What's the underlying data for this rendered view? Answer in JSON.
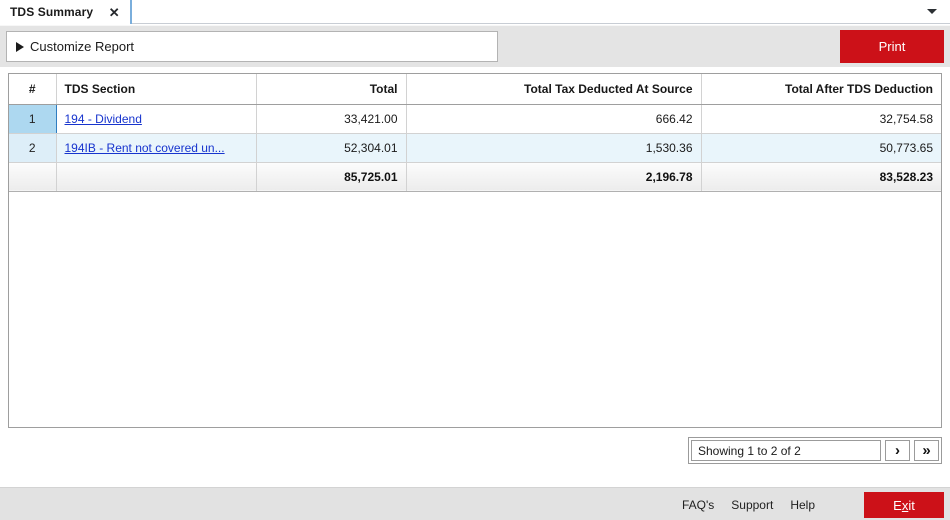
{
  "tabbar": {
    "tabs": [
      {
        "label": "TDS Summary",
        "close_icon": "close-icon"
      }
    ],
    "dropdown_icon": "chevron-down-icon"
  },
  "toolbar": {
    "customize_label": "Customize Report",
    "customize_icon": "triangle-right-icon",
    "print_label": "Print"
  },
  "grid": {
    "columns": [
      {
        "key": "num",
        "label": "#"
      },
      {
        "key": "sec",
        "label": "TDS Section"
      },
      {
        "key": "total",
        "label": "Total"
      },
      {
        "key": "tds",
        "label": "Total Tax Deducted At Source"
      },
      {
        "key": "after",
        "label": "Total After TDS Deduction"
      }
    ],
    "rows": [
      {
        "num": "1",
        "section": "194 - Dividend",
        "total": "33,421.00",
        "tds": "666.42",
        "after": "32,754.58"
      },
      {
        "num": "2",
        "section": "194IB  -  Rent  not  covered  un...",
        "total": "52,304.01",
        "tds": "1,530.36",
        "after": "50,773.65"
      }
    ],
    "totals": {
      "num": "",
      "section": "",
      "total": "85,725.01",
      "tds": "2,196.78",
      "after": "83,528.23"
    }
  },
  "pager": {
    "status": "Showing 1 to 2 of 2",
    "next_label": "›",
    "last_label": "»"
  },
  "footer": {
    "links": [
      {
        "label": "FAQ's"
      },
      {
        "label": "Support"
      },
      {
        "label": "Help"
      }
    ],
    "exit_prefix": "E",
    "exit_accel": "x",
    "exit_suffix": "it"
  },
  "colors": {
    "brand_red": "#cc1118",
    "link_blue": "#1734ce",
    "selected_row": "#add8f0",
    "alt_row": "#e9f5fb",
    "toolbar_gray": "#e4e4e4"
  }
}
